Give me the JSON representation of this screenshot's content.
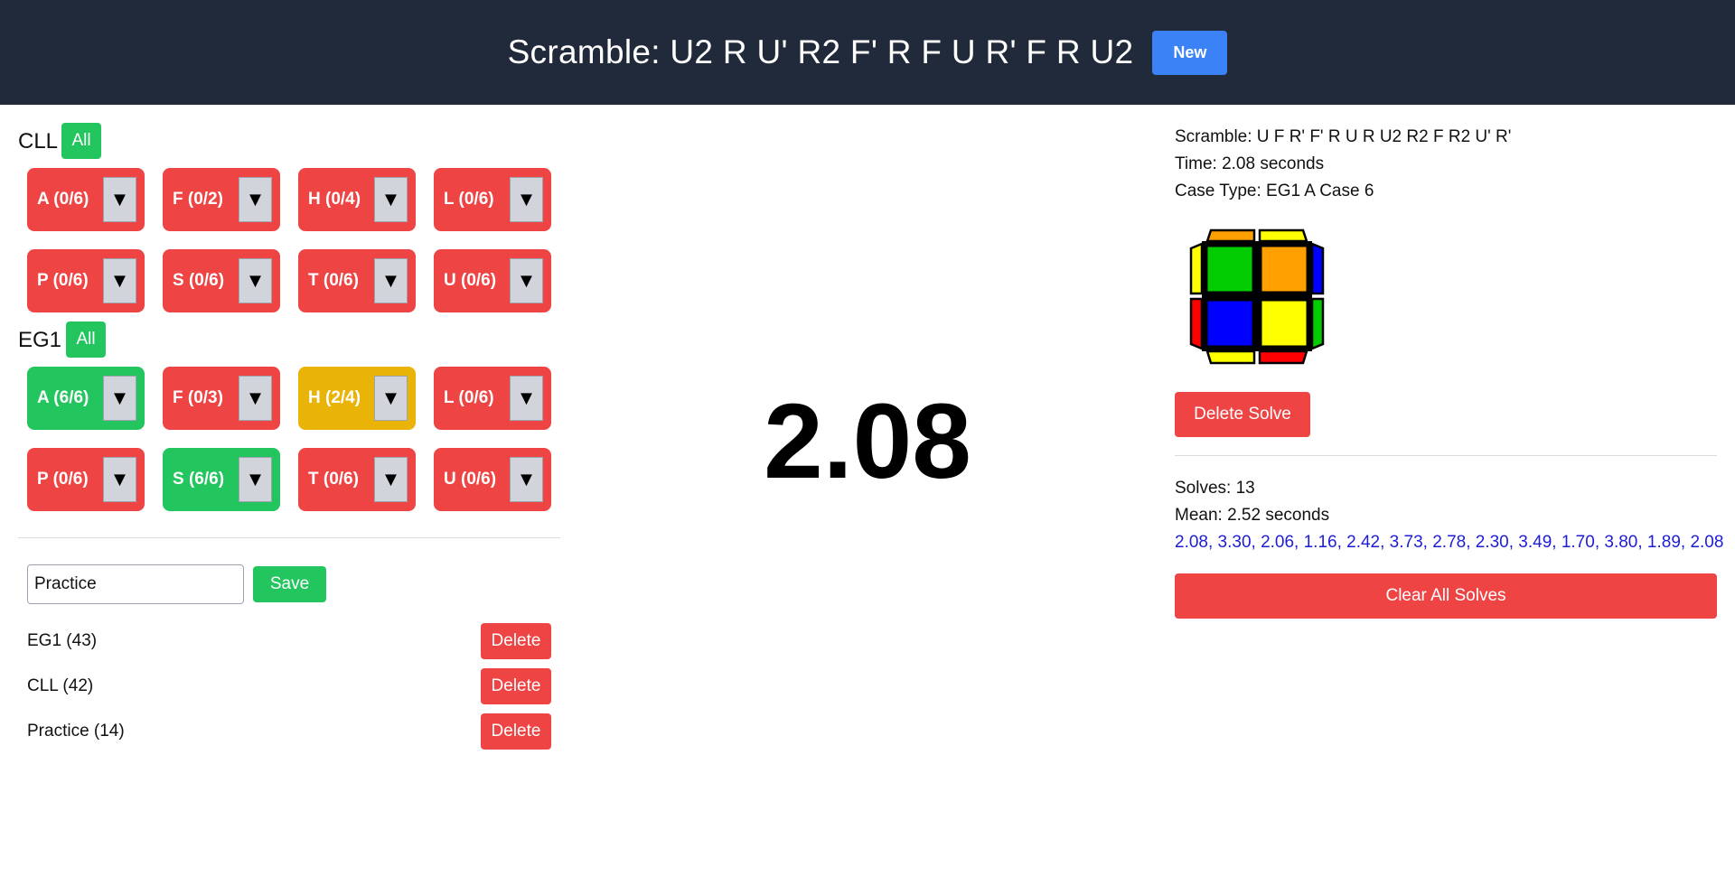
{
  "header": {
    "title": "Scramble: U2 R U' R2 F' R F U R' F R U2",
    "new_label": "New"
  },
  "groups": {
    "cll": {
      "label": "CLL",
      "all_label": "All",
      "cases": [
        {
          "label": "A (0/6)",
          "state": "red"
        },
        {
          "label": "F (0/2)",
          "state": "red"
        },
        {
          "label": "H (0/4)",
          "state": "red"
        },
        {
          "label": "L (0/6)",
          "state": "red"
        },
        {
          "label": "P (0/6)",
          "state": "red"
        },
        {
          "label": "S (0/6)",
          "state": "red"
        },
        {
          "label": "T (0/6)",
          "state": "red"
        },
        {
          "label": "U (0/6)",
          "state": "red"
        }
      ]
    },
    "eg1": {
      "label": "EG1",
      "all_label": "All",
      "cases": [
        {
          "label": "A (6/6)",
          "state": "green"
        },
        {
          "label": "F (0/3)",
          "state": "red"
        },
        {
          "label": "H (2/4)",
          "state": "yellow"
        },
        {
          "label": "L (0/6)",
          "state": "red"
        },
        {
          "label": "P (0/6)",
          "state": "red"
        },
        {
          "label": "S (6/6)",
          "state": "green"
        },
        {
          "label": "T (0/6)",
          "state": "red"
        },
        {
          "label": "U (0/6)",
          "state": "red"
        }
      ]
    },
    "dropdown_glyph": "▼"
  },
  "save_form": {
    "input_value": "Practice",
    "save_label": "Save"
  },
  "saved_sets": [
    {
      "name": "EG1 (43)",
      "delete_label": "Delete"
    },
    {
      "name": "CLL (42)",
      "delete_label": "Delete"
    },
    {
      "name": "Practice (14)",
      "delete_label": "Delete"
    }
  ],
  "timer": {
    "display": "2.08"
  },
  "last_solve": {
    "scramble": "Scramble: U F R' F' R U R U2 R2 F R2 U' R'",
    "time": "Time: 2.08 seconds",
    "case_type": "Case Type: EG1 A Case 6",
    "delete_label": "Delete Solve"
  },
  "cube_colors": {
    "top": [
      "#00cc00",
      "#ff9f00",
      "#0000ff",
      "#ffff00"
    ],
    "back": [
      "#ff9f00",
      "#ffff00"
    ],
    "front": [
      "#ffff00",
      "#ff0000"
    ],
    "left": [
      "#ffff00",
      "#ff0000"
    ],
    "right": [
      "#0000ff",
      "#00cc00"
    ]
  },
  "stats": {
    "solves": "Solves: 13",
    "mean": "Mean: 2.52 seconds",
    "times": "2.08, 3.30, 2.06, 1.16, 2.42, 3.73, 2.78, 2.30, 3.49, 1.70, 3.80, 1.89, 2.08",
    "clear_label": "Clear All Solves"
  }
}
